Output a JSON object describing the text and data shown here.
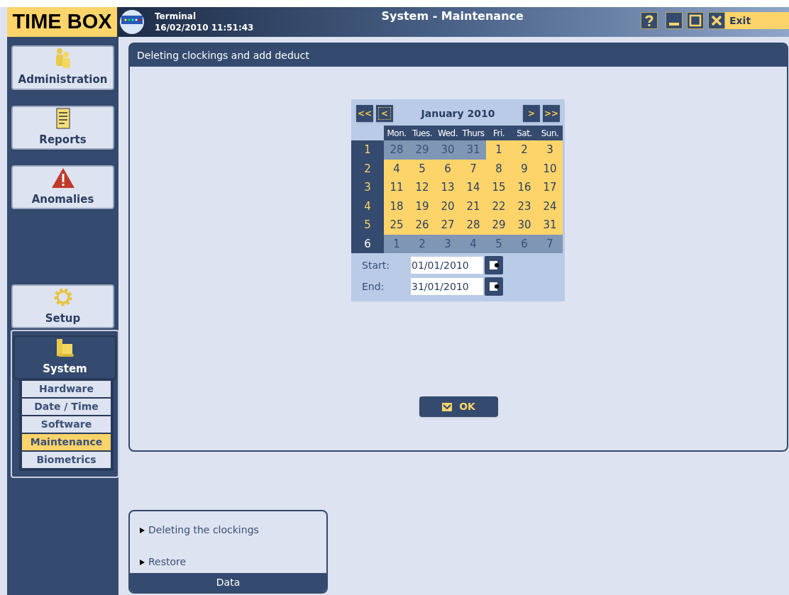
{
  "app": {
    "logo": "TIME BOX",
    "terminal_label": "Terminal",
    "datetime": "16/02/2010 11:51:43",
    "title": "System - Maintenance",
    "exit": "Exit"
  },
  "sidebar": {
    "items": [
      {
        "label": "Administration",
        "kind": "admin",
        "selected": false
      },
      {
        "label": "Reports",
        "kind": "reports",
        "selected": false
      },
      {
        "label": "Anomalies",
        "kind": "anomalies",
        "selected": false
      },
      {
        "label": "Setup",
        "kind": "setup",
        "selected": false
      },
      {
        "label": "System",
        "kind": "system",
        "selected": true
      }
    ],
    "sub_items": [
      {
        "label": "Hardware",
        "selected": false
      },
      {
        "label": "Date / Time",
        "selected": false
      },
      {
        "label": "Software",
        "selected": false
      },
      {
        "label": "Maintenance",
        "selected": true
      },
      {
        "label": "Biometrics",
        "selected": false
      }
    ]
  },
  "panel": {
    "title": "Deleting clockings and add deduct",
    "calendar": {
      "month": "January 2010",
      "prev_year": "<<",
      "prev_month": "<",
      "next_month": ">",
      "next_year": ">>",
      "weekdays": [
        "Mon.",
        "Tues.",
        "Wed.",
        "Thurs",
        "Fri.",
        "Sat.",
        "Sun."
      ],
      "weeks": [
        {
          "number": "1",
          "days": [
            {
              "label": "28",
              "in_month": false
            },
            {
              "label": "29",
              "in_month": false
            },
            {
              "label": "30",
              "in_month": false
            },
            {
              "label": "31",
              "in_month": false
            },
            {
              "label": "1",
              "in_month": true
            },
            {
              "label": "2",
              "in_month": true
            },
            {
              "label": "3",
              "in_month": true
            }
          ]
        },
        {
          "number": "2",
          "days": [
            {
              "label": "4",
              "in_month": true
            },
            {
              "label": "5",
              "in_month": true
            },
            {
              "label": "6",
              "in_month": true
            },
            {
              "label": "7",
              "in_month": true
            },
            {
              "label": "8",
              "in_month": true
            },
            {
              "label": "9",
              "in_month": true
            },
            {
              "label": "10",
              "in_month": true
            }
          ]
        },
        {
          "number": "3",
          "days": [
            {
              "label": "11",
              "in_month": true
            },
            {
              "label": "12",
              "in_month": true
            },
            {
              "label": "13",
              "in_month": true
            },
            {
              "label": "14",
              "in_month": true
            },
            {
              "label": "15",
              "in_month": true
            },
            {
              "label": "16",
              "in_month": true
            },
            {
              "label": "17",
              "in_month": true
            }
          ]
        },
        {
          "number": "4",
          "days": [
            {
              "label": "18",
              "in_month": true
            },
            {
              "label": "19",
              "in_month": true
            },
            {
              "label": "20",
              "in_month": true
            },
            {
              "label": "21",
              "in_month": true
            },
            {
              "label": "22",
              "in_month": true
            },
            {
              "label": "23",
              "in_month": true
            },
            {
              "label": "24",
              "in_month": true
            }
          ]
        },
        {
          "number": "5",
          "days": [
            {
              "label": "25",
              "in_month": true
            },
            {
              "label": "26",
              "in_month": true
            },
            {
              "label": "27",
              "in_month": true
            },
            {
              "label": "28",
              "in_month": true
            },
            {
              "label": "29",
              "in_month": true
            },
            {
              "label": "30",
              "in_month": true
            },
            {
              "label": "31",
              "in_month": true
            }
          ]
        },
        {
          "number": "6",
          "days": [
            {
              "label": "1",
              "in_month": false
            },
            {
              "label": "2",
              "in_month": false
            },
            {
              "label": "3",
              "in_month": false
            },
            {
              "label": "4",
              "in_month": false
            },
            {
              "label": "5",
              "in_month": false
            },
            {
              "label": "6",
              "in_month": false
            },
            {
              "label": "7",
              "in_month": false
            }
          ]
        }
      ],
      "fields": [
        {
          "label": "Start:",
          "value": "01/01/2010"
        },
        {
          "label": "End:",
          "value": "31/01/2010"
        }
      ]
    },
    "ok_button": "OK"
  },
  "data_box": {
    "links": [
      "Deleting the clockings",
      "Restore"
    ],
    "footer": "Data"
  }
}
